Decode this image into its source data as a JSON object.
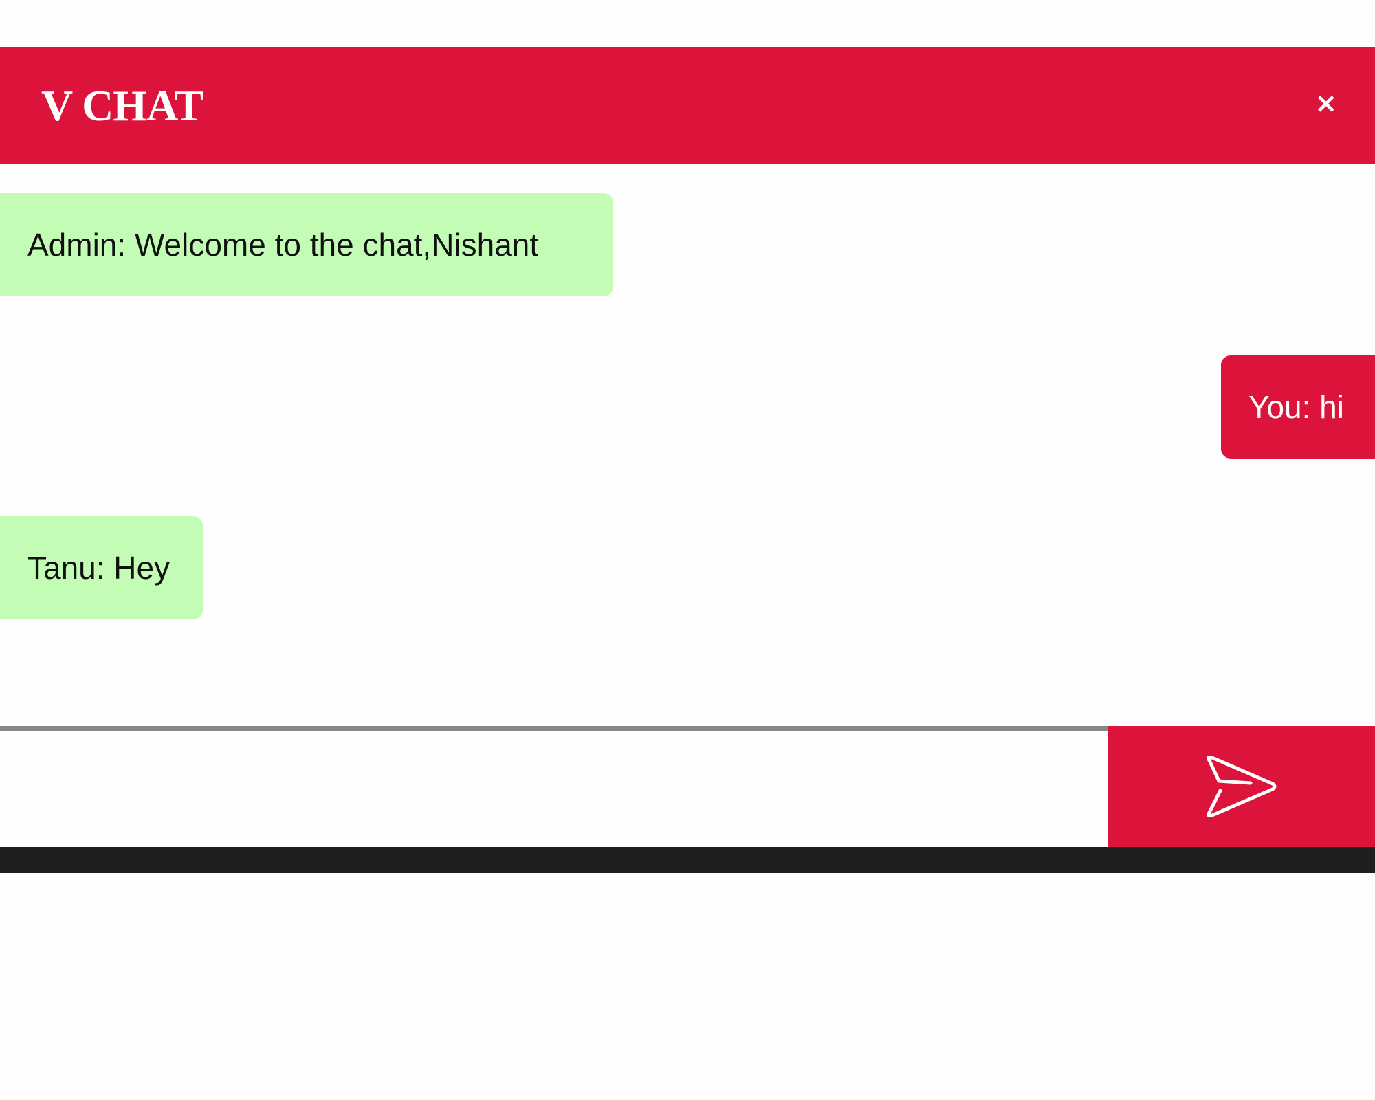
{
  "header": {
    "title": "V CHAT",
    "close_label": "×"
  },
  "messages": [
    {
      "text": "Admin: Welcome to the chat,Nishant",
      "side": "received"
    },
    {
      "text": "You: hi",
      "side": "sent"
    },
    {
      "text": "Tanu: Hey",
      "side": "received"
    }
  ],
  "composer": {
    "value": "",
    "send_icon": "paper-plane-icon"
  },
  "colors": {
    "accent": "#dc143c",
    "received_bubble": "#c3fdb5",
    "footer_bar": "#201e1f"
  }
}
